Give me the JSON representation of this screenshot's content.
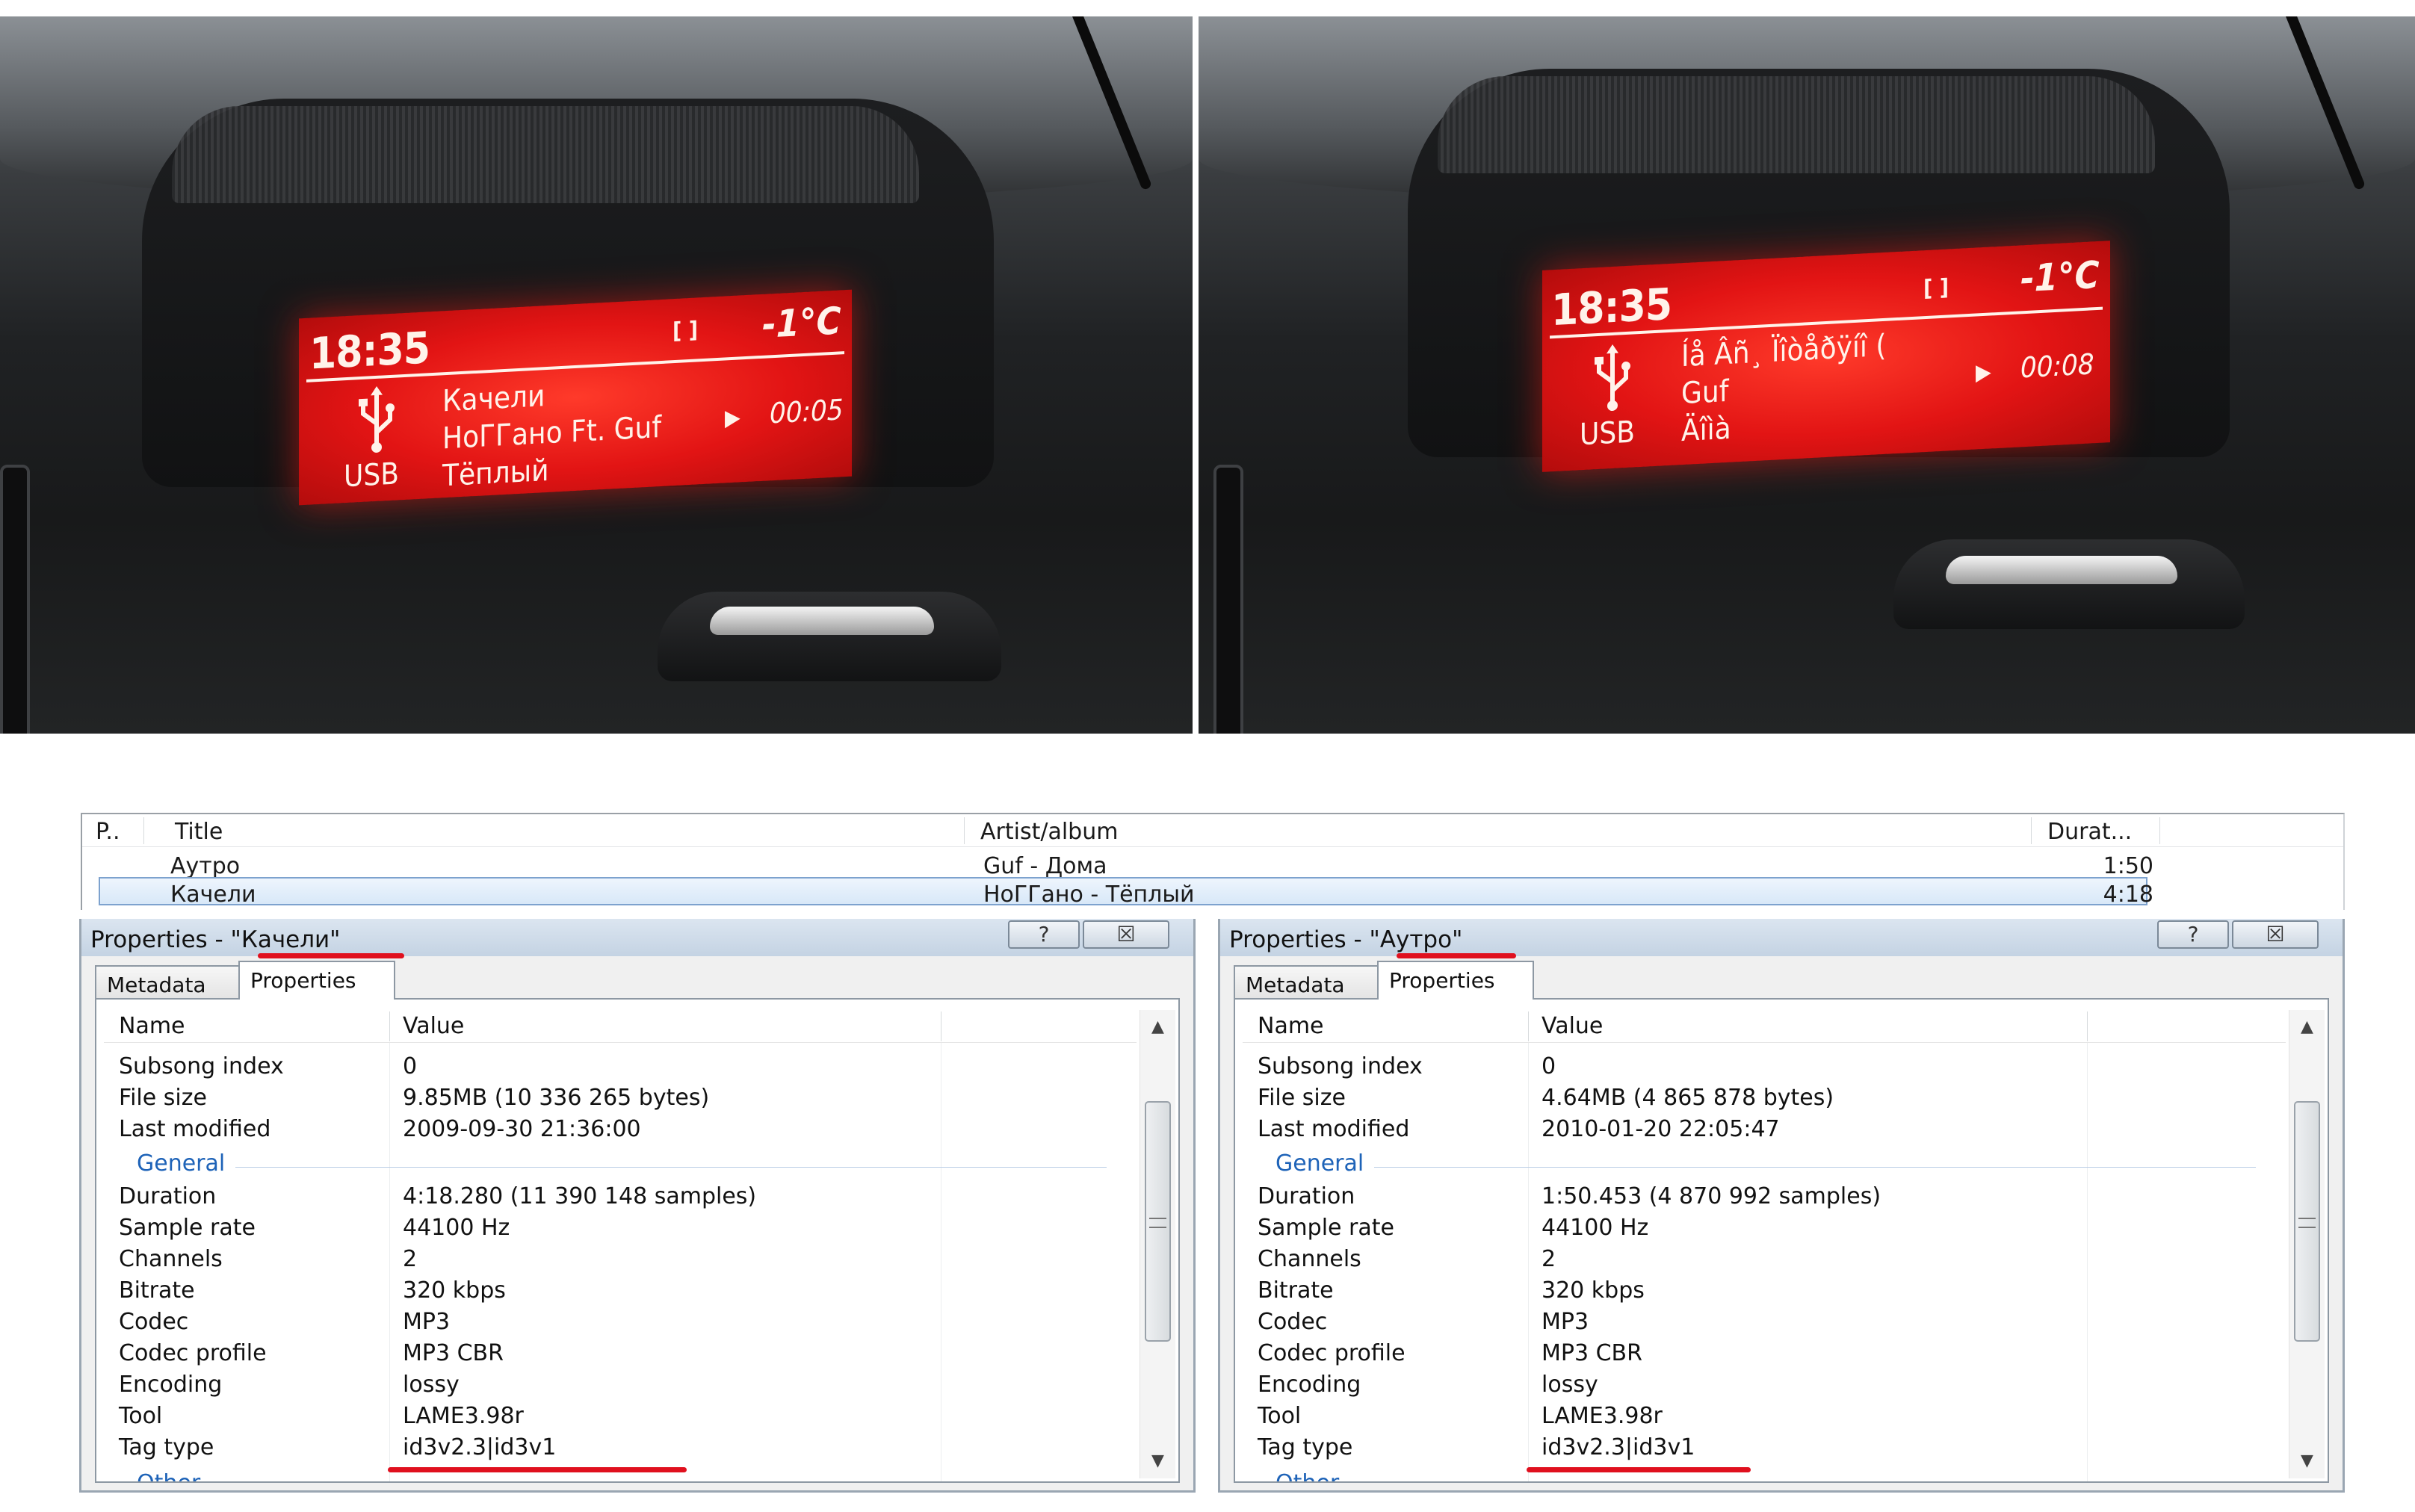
{
  "photos": {
    "left": {
      "time": "18:35",
      "brackets": "[ ]",
      "temp": "-1°C",
      "line1": "Качели",
      "line2": "НоГГано Ft. Guf",
      "line3": "Тёплый",
      "elapsed": "00:05",
      "source": "USB"
    },
    "right": {
      "time": "18:35",
      "brackets": "[ ]",
      "temp": "-1°C",
      "line1": "Íå Âñ¸ Ïîòåðÿíî (",
      "line2": "Guf",
      "line3": "Äîìà",
      "elapsed": "00:08",
      "source": "USB"
    }
  },
  "playlist": {
    "columns": [
      "P..",
      "Title",
      "Artist/album",
      "Durat..."
    ],
    "rows": [
      {
        "title": "Аутро",
        "artist": "Guf - Дома",
        "duration": "1:50"
      },
      {
        "title": "Качели",
        "artist": "НоГГано - Тёплый",
        "duration": "4:18"
      }
    ]
  },
  "windows": {
    "left": {
      "title": "Properties - \"Качели\"",
      "help": "?",
      "close": "☒",
      "tabs": [
        "Metadata",
        "Properties"
      ],
      "col_name": "Name",
      "col_value": "Value",
      "rows_top": [
        {
          "k": "Subsong index",
          "v": "0"
        },
        {
          "k": "File size",
          "v": "9.85MB (10 336 265 bytes)"
        },
        {
          "k": "Last modified",
          "v": "2009-09-30 21:36:00"
        }
      ],
      "group_general": "General",
      "rows_general": [
        {
          "k": "Duration",
          "v": "4:18.280 (11 390 148 samples)"
        },
        {
          "k": "Sample rate",
          "v": "44100 Hz"
        },
        {
          "k": "Channels",
          "v": "2"
        },
        {
          "k": "Bitrate",
          "v": "320 kbps"
        },
        {
          "k": "Codec",
          "v": "MP3"
        },
        {
          "k": "Codec profile",
          "v": "MP3 CBR"
        },
        {
          "k": "Encoding",
          "v": "lossy"
        },
        {
          "k": "Tool",
          "v": "LAME3.98r"
        },
        {
          "k": "Tag type",
          "v": "id3v2.3|id3v1"
        }
      ],
      "group_other": "Other"
    },
    "right": {
      "title": "Properties - \"Аутро\"",
      "help": "?",
      "close": "☒",
      "tabs": [
        "Metadata",
        "Properties"
      ],
      "col_name": "Name",
      "col_value": "Value",
      "rows_top": [
        {
          "k": "Subsong index",
          "v": "0"
        },
        {
          "k": "File size",
          "v": "4.64MB (4 865 878 bytes)"
        },
        {
          "k": "Last modified",
          "v": "2010-01-20 22:05:47"
        }
      ],
      "group_general": "General",
      "rows_general": [
        {
          "k": "Duration",
          "v": "1:50.453 (4 870 992 samples)"
        },
        {
          "k": "Sample rate",
          "v": "44100 Hz"
        },
        {
          "k": "Channels",
          "v": "2"
        },
        {
          "k": "Bitrate",
          "v": "320 kbps"
        },
        {
          "k": "Codec",
          "v": "MP3"
        },
        {
          "k": "Codec profile",
          "v": "MP3 CBR"
        },
        {
          "k": "Encoding",
          "v": "lossy"
        },
        {
          "k": "Tool",
          "v": "LAME3.98r"
        },
        {
          "k": "Tag type",
          "v": "id3v2.3|id3v1"
        }
      ],
      "group_other": "Other"
    }
  },
  "colors": {
    "screen_red": "#e21414",
    "highlight_red": "#e0101e",
    "group_blue": "#1e63b8",
    "selection": "#d8e8f8"
  }
}
